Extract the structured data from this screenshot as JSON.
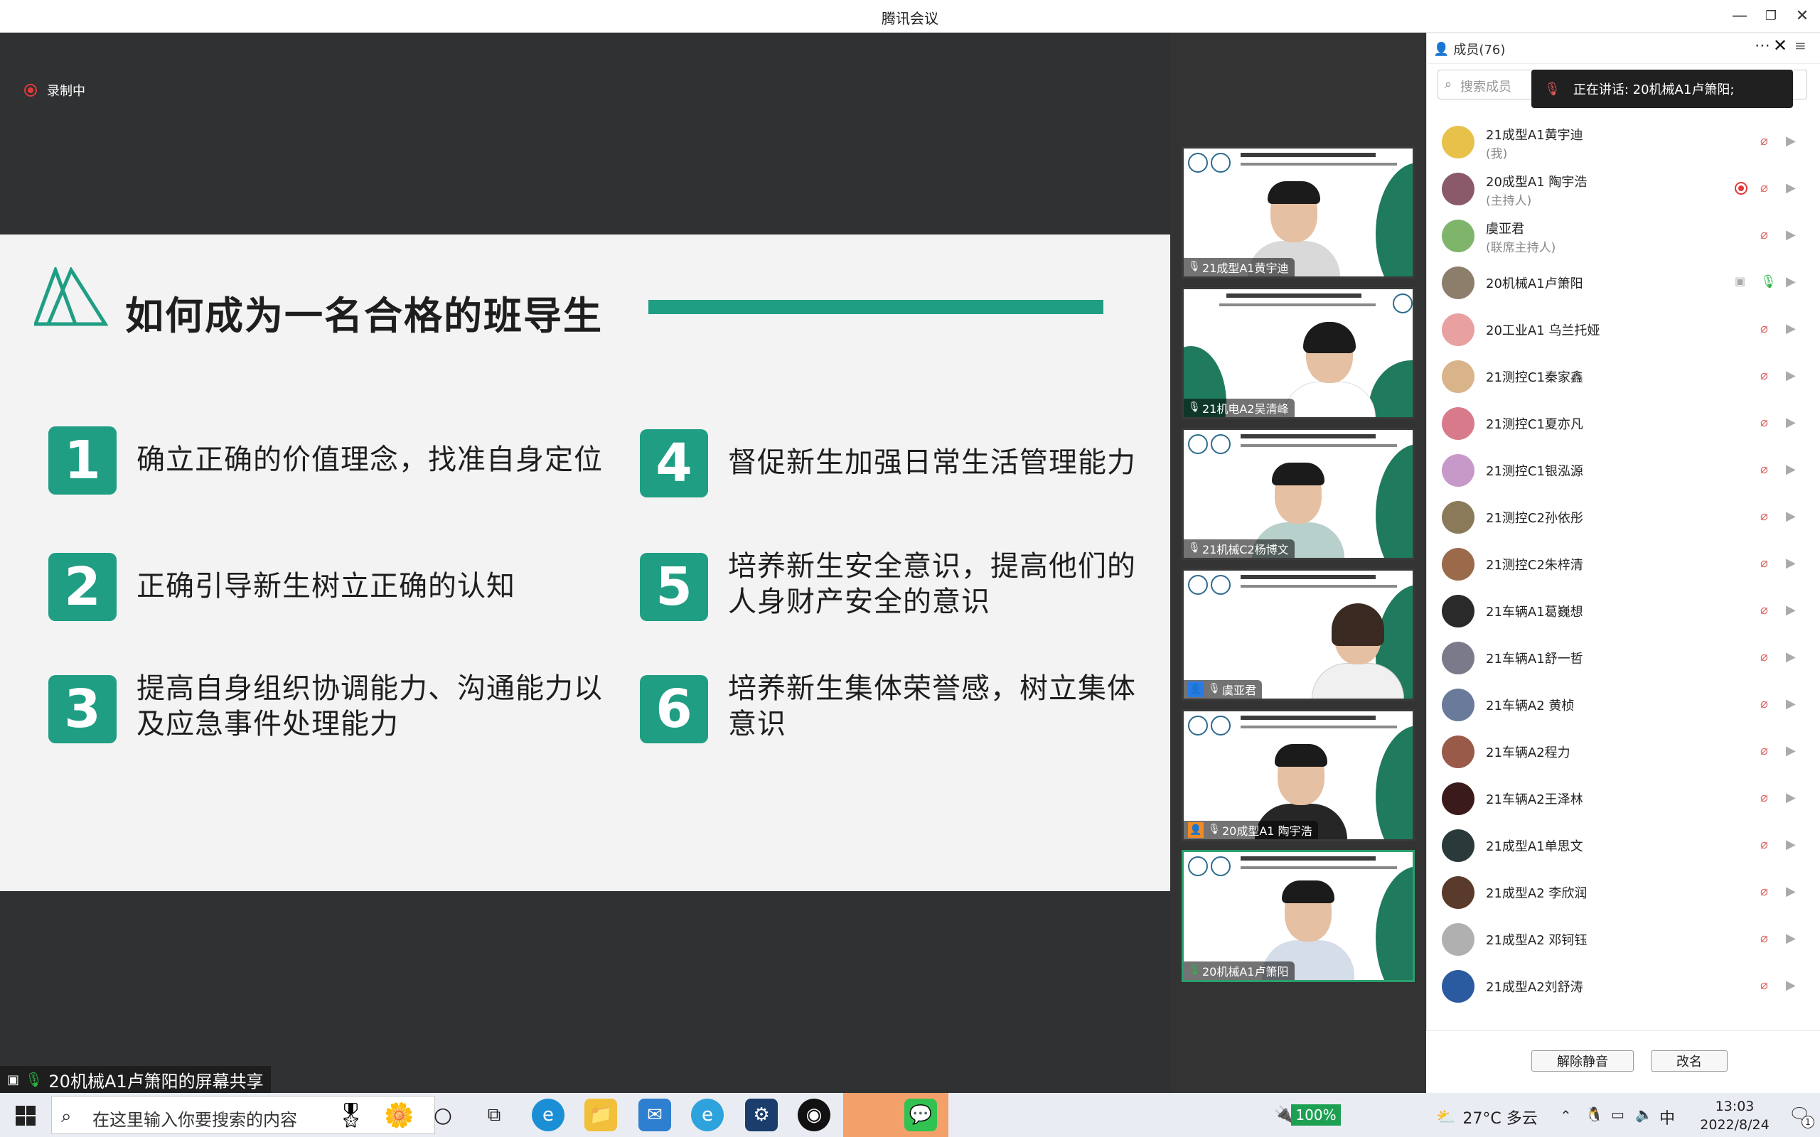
{
  "window": {
    "title": "腾讯会议",
    "min_icon": "minimize-icon",
    "restore_icon": "restore-icon",
    "close_icon": "close-icon"
  },
  "recording": {
    "label": "录制中"
  },
  "slide": {
    "title": "如何成为一名合格的班导生",
    "accent": "#1f9e83",
    "items": [
      {
        "num": "1",
        "text": "确立正确的价值理念，找准自身定位"
      },
      {
        "num": "2",
        "text": "正确引导新生树立正确的认知"
      },
      {
        "num": "3",
        "text": "提高自身组织协调能力、沟通能力以及应急事件处理能力"
      },
      {
        "num": "4",
        "text": "督促新生加强日常生活管理能力"
      },
      {
        "num": "5",
        "text": "培养新生安全意识，提高他们的人身财产安全的意识"
      },
      {
        "num": "6",
        "text": "培养新生集体荣誉感，树立集体意识"
      }
    ]
  },
  "share_label": "20机械A1卢箫阳的屏幕共享",
  "tiles": [
    {
      "name": "21成型A1黄宇迪",
      "mic": "muted"
    },
    {
      "name": "21机电A2吴清峰",
      "mic": "muted"
    },
    {
      "name": "21机械C2杨博文",
      "mic": "muted"
    },
    {
      "name": "虞亚君",
      "mic": "muted"
    },
    {
      "name": "20成型A1 陶宇浩",
      "mic": "muted"
    },
    {
      "name": "20机械A1卢箫阳",
      "mic": "on"
    }
  ],
  "panel": {
    "title": "成员(76)",
    "search_placeholder": "搜索成员",
    "speaking": "正在讲话: 20机械A1卢箫阳;",
    "members": [
      {
        "name": "21成型A1黄宇迪",
        "role": "(我)",
        "color": "#e7c14a"
      },
      {
        "name": "20成型A1 陶宇浩",
        "role": "(主持人)",
        "color": "#8a5a6a",
        "rec": true
      },
      {
        "name": "虞亚君",
        "role": "(联席主持人)",
        "color": "#7fb56a"
      },
      {
        "name": "20机械A1卢箫阳",
        "role": "",
        "color": "#8c7e6a",
        "speaking": true
      },
      {
        "name": "20工业A1 乌兰托娅",
        "role": "",
        "color": "#e8a0a0"
      },
      {
        "name": "21测控C1秦家鑫",
        "role": "",
        "color": "#d9b48a"
      },
      {
        "name": "21测控C1夏亦凡",
        "role": "",
        "color": "#d87a8a"
      },
      {
        "name": "21测控C1银泓源",
        "role": "",
        "color": "#c799c9"
      },
      {
        "name": "21测控C2孙依彤",
        "role": "",
        "color": "#8a7a5a"
      },
      {
        "name": "21测控C2朱梓清",
        "role": "",
        "color": "#9a6a4a"
      },
      {
        "name": "21车辆A1葛巍想",
        "role": "",
        "color": "#2a2a2a"
      },
      {
        "name": "21车辆A1舒一哲",
        "role": "",
        "color": "#7a7a8a"
      },
      {
        "name": "21车辆A2 黄桢",
        "role": "",
        "color": "#6a7a9a"
      },
      {
        "name": "21车辆A2程力",
        "role": "",
        "color": "#9a5a4a"
      },
      {
        "name": "21车辆A2王泽林",
        "role": "",
        "color": "#3a1a1a"
      },
      {
        "name": "21成型A1单思文",
        "role": "",
        "color": "#2a3a3a"
      },
      {
        "name": "21成型A2  李欣润",
        "role": "",
        "color": "#5a3a2a"
      },
      {
        "name": "21成型A2 邓钶钰",
        "role": "",
        "color": "#b0b0b0"
      },
      {
        "name": "21成型A2刘舒涛",
        "role": "",
        "color": "#2a5aa0"
      }
    ],
    "btn_mute": "解除静音",
    "btn_rename": "改名"
  },
  "taskbar": {
    "search_text": "在这里输入你要搜索的内容",
    "battery": "100%",
    "weather": "27°C 多云",
    "ime": "中",
    "time": "13:03",
    "date": "2022/8/24",
    "notif": "1"
  }
}
